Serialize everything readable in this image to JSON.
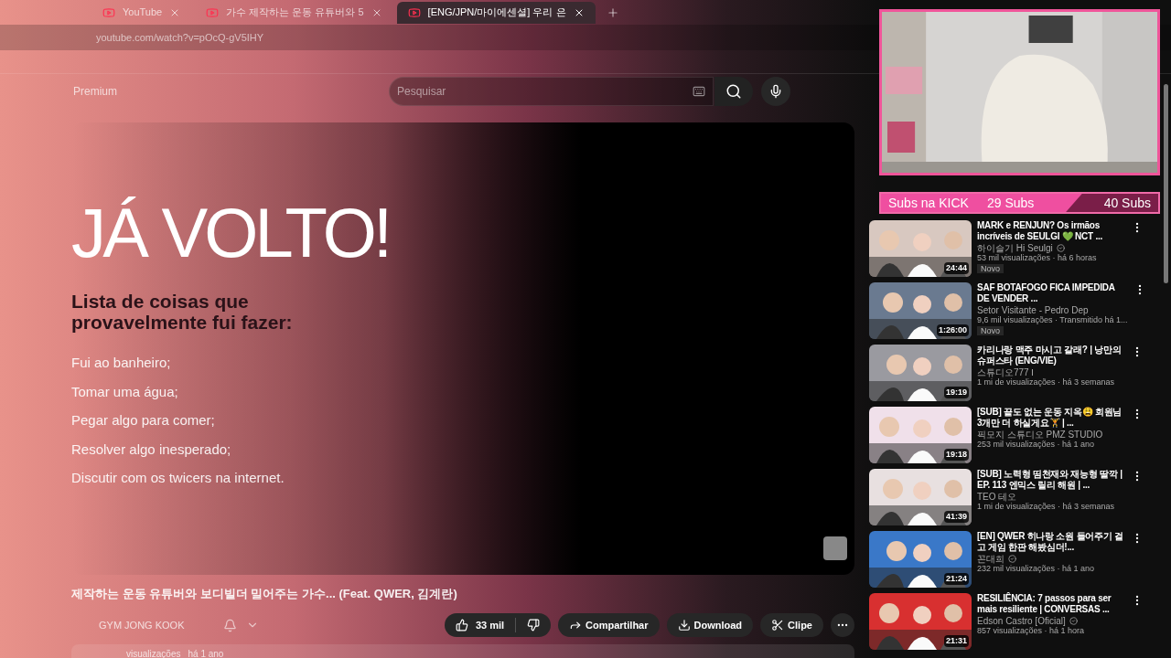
{
  "tabs": [
    {
      "title": "YouTube",
      "selected": false
    },
    {
      "title": "가수 제작하는 운동 유튜버와 5",
      "selected": false
    },
    {
      "title": "[ENG/JPN/마이에센셜] 우리 은",
      "selected": true
    }
  ],
  "address": "youtube.com/watch?v=pOcQ-gV5IHY",
  "logo": "Premium",
  "search": {
    "placeholder": "Pesquisar"
  },
  "overlay": {
    "title": "JÁ VOLTO!",
    "subtitle": "Lista de coisas que provavelmente fui fazer:",
    "items": [
      "Fui ao banheiro;",
      "Tomar uma água;",
      "Pegar algo para comer;",
      "Resolver algo inesperado;",
      "Discutir com os twicers na internet."
    ]
  },
  "video": {
    "title": "제작하는 운동 유튜버와 보디빌더 밀어주는 가수... (Feat. QWER, 김계란)",
    "channel": "GYM JONG KOOK",
    "views": "visualizações",
    "age": "há 1 ano",
    "likes": "33 mil",
    "actions": [
      "Compartilhar",
      "Download",
      "Clipe"
    ]
  },
  "camera": {
    "label": "Subs na KICK",
    "current": "29 Subs",
    "goal": "40 Subs",
    "level": 0.725
  },
  "recommendations": [
    {
      "title": "MARK e RENJUN? Os irmãos incríveis de SEULGI 💚 NCT ...",
      "channel": "하이슬기 Hi Seulgi",
      "verified": true,
      "stats": "53 mil visualizações · há 6 horas",
      "duration": "24:44",
      "badge": "Novo"
    },
    {
      "title": "SAF BOTAFOGO FICA IMPEDIDA DE VENDER ...",
      "channel": "Setor Visitante - Pedro Dep",
      "verified": false,
      "stats": "9,6 mil visualizações · Transmitido há 1...",
      "duration": "1:26:00",
      "badge": "Novo"
    },
    {
      "title": "카리나랑 맥주 마시고 갈래? | 낭만의 슈퍼스타 (ENG/VIE)",
      "channel": "스튜디오777 Ⅰ",
      "verified": false,
      "stats": "1 mi de visualizações · há 3 semanas",
      "duration": "19:19"
    },
    {
      "title": "[SUB] 끝도 없는 운동 지옥😩 회원님 3개만 더 하실게요🏋 | ...",
      "channel": "픽모지 스튜디오 PMZ STUDIO",
      "verified": false,
      "stats": "253 mil visualizações · há 1 ano",
      "duration": "19:18"
    },
    {
      "title": "[SUB] 노력형 띰천재와 재능형 딸깍 | EP. 113 엔믹스 릴리 해원 | ...",
      "channel": "TEO 테오",
      "verified": false,
      "stats": "1 mi de visualizações · há 3 semanas",
      "duration": "41:39"
    },
    {
      "title": "[EN] QWER 히나랑 소원 들어주기 걸고 게임 한판 해봤심더!...",
      "channel": "꼰대희",
      "verified": true,
      "stats": "232 mil visualizações · há 1 ano",
      "duration": "21:24"
    },
    {
      "title": "RESILIÊNCIA: 7 passos para ser mais resiliente | CONVERSAS ...",
      "channel": "Edson Castro [Oficial]",
      "verified": true,
      "stats": "857 visualizações · há 1 hora",
      "duration": "21:31"
    }
  ]
}
